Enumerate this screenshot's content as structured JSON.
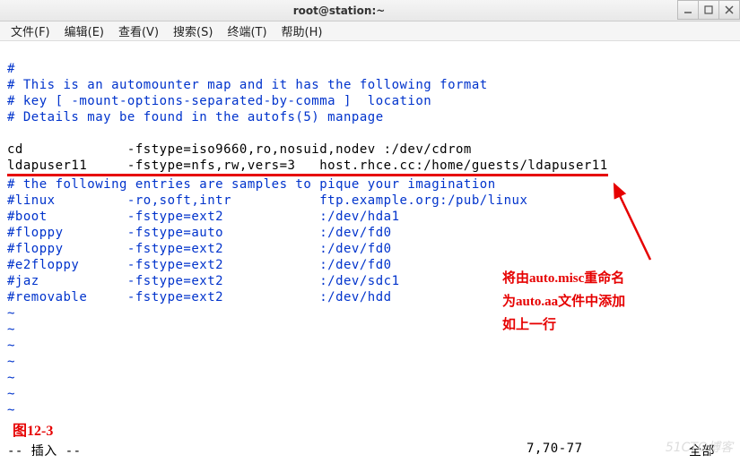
{
  "window": {
    "title": "root@station:~"
  },
  "menu": {
    "file": "文件(F)",
    "edit": "编辑(E)",
    "view": "查看(V)",
    "search": "搜索(S)",
    "terminal": "终端(T)",
    "help": "帮助(H)"
  },
  "lines": {
    "l1": "#",
    "l2": "# This is an automounter map and it has the following format",
    "l3": "# key [ -mount-options-separated-by-comma ]  location",
    "l4": "# Details may be found in the autofs(5) manpage",
    "l5": "",
    "l6": "cd             -fstype=iso9660,ro,nosuid,nodev :/dev/cdrom",
    "l7": "ldapuser11     -fstype=nfs,rw,vers=3   host.rhce.cc:/home/guests/ldapuser11",
    "l8": "# the following entries are samples to pique your imagination",
    "l9": "#linux         -ro,soft,intr           ftp.example.org:/pub/linux",
    "l10": "#boot          -fstype=ext2            :/dev/hda1",
    "l11": "#floppy        -fstype=auto            :/dev/fd0",
    "l12": "#floppy        -fstype=ext2            :/dev/fd0",
    "l13": "#e2floppy      -fstype=ext2            :/dev/fd0",
    "l14": "#jaz           -fstype=ext2            :/dev/sdc1",
    "l15": "#removable     -fstype=ext2            :/dev/hdd",
    "tilde": "~"
  },
  "annotation": {
    "line1": "将由auto.misc重命名",
    "line2": "为auto.aa文件中添加",
    "line3": "如上一行"
  },
  "figure_label": "图12-3",
  "status": {
    "mode": "-- 插入 --",
    "pos": "7,70-77",
    "scroll": "全部"
  },
  "watermark": "51CTO博客"
}
